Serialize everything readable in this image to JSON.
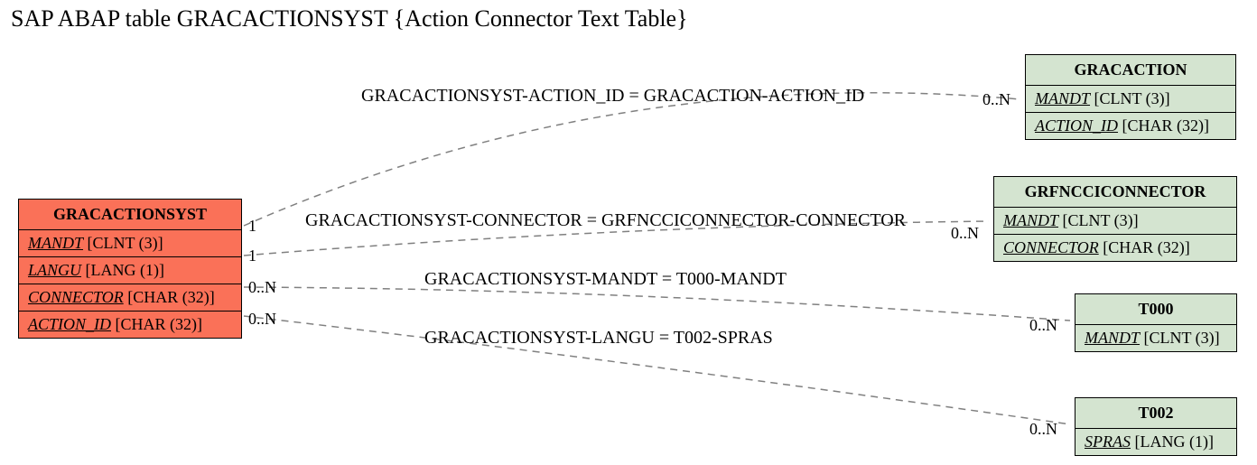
{
  "title": "SAP ABAP table GRACACTIONSYST {Action Connector Text Table}",
  "entities": {
    "main": {
      "name": "GRACACTIONSYST",
      "fields": [
        {
          "key": "MANDT",
          "type": "[CLNT (3)]"
        },
        {
          "key": "LANGU",
          "type": "[LANG (1)]"
        },
        {
          "key": "CONNECTOR",
          "type": "[CHAR (32)]"
        },
        {
          "key": "ACTION_ID",
          "type": "[CHAR (32)]"
        }
      ]
    },
    "e1": {
      "name": "GRACACTION",
      "fields": [
        {
          "key": "MANDT",
          "type": "[CLNT (3)]"
        },
        {
          "key": "ACTION_ID",
          "type": "[CHAR (32)]"
        }
      ]
    },
    "e2": {
      "name": "GRFNCCICONNECTOR",
      "fields": [
        {
          "key": "MANDT",
          "type": "[CLNT (3)]"
        },
        {
          "key": "CONNECTOR",
          "type": "[CHAR (32)]"
        }
      ]
    },
    "e3": {
      "name": "T000",
      "fields": [
        {
          "key": "MANDT",
          "type": "[CLNT (3)]"
        }
      ]
    },
    "e4": {
      "name": "T002",
      "fields": [
        {
          "key": "SPRAS",
          "type": "[LANG (1)]"
        }
      ]
    }
  },
  "relations": {
    "r1": {
      "label": "GRACACTIONSYST-ACTION_ID = GRACACTION-ACTION_ID",
      "left_card": "1",
      "right_card": "0..N"
    },
    "r2": {
      "label": "GRACACTIONSYST-CONNECTOR = GRFNCCICONNECTOR-CONNECTOR",
      "left_card": "1",
      "right_card": "0..N"
    },
    "r3": {
      "label": "GRACACTIONSYST-MANDT = T000-MANDT",
      "left_card": "0..N",
      "right_card": "0..N"
    },
    "r4": {
      "label": "GRACACTIONSYST-LANGU = T002-SPRAS",
      "left_card": "0..N",
      "right_card": "0..N"
    }
  },
  "chart_data": {
    "type": "table",
    "description": "ER-diagram relationships for SAP ABAP table GRACACTIONSYST",
    "main_entity": {
      "name": "GRACACTIONSYST",
      "columns": [
        {
          "name": "MANDT",
          "datatype": "CLNT",
          "length": 3
        },
        {
          "name": "LANGU",
          "datatype": "LANG",
          "length": 1
        },
        {
          "name": "CONNECTOR",
          "datatype": "CHAR",
          "length": 32
        },
        {
          "name": "ACTION_ID",
          "datatype": "CHAR",
          "length": 32
        }
      ]
    },
    "related_entities": [
      {
        "name": "GRACACTION",
        "columns": [
          {
            "name": "MANDT",
            "datatype": "CLNT",
            "length": 3
          },
          {
            "name": "ACTION_ID",
            "datatype": "CHAR",
            "length": 32
          }
        ]
      },
      {
        "name": "GRFNCCICONNECTOR",
        "columns": [
          {
            "name": "MANDT",
            "datatype": "CLNT",
            "length": 3
          },
          {
            "name": "CONNECTOR",
            "datatype": "CHAR",
            "length": 32
          }
        ]
      },
      {
        "name": "T000",
        "columns": [
          {
            "name": "MANDT",
            "datatype": "CLNT",
            "length": 3
          }
        ]
      },
      {
        "name": "T002",
        "columns": [
          {
            "name": "SPRAS",
            "datatype": "LANG",
            "length": 1
          }
        ]
      }
    ],
    "relationships": [
      {
        "from": "GRACACTIONSYST.ACTION_ID",
        "to": "GRACACTION.ACTION_ID",
        "from_card": "1",
        "to_card": "0..N"
      },
      {
        "from": "GRACACTIONSYST.CONNECTOR",
        "to": "GRFNCCICONNECTOR.CONNECTOR",
        "from_card": "1",
        "to_card": "0..N"
      },
      {
        "from": "GRACACTIONSYST.MANDT",
        "to": "T000.MANDT",
        "from_card": "0..N",
        "to_card": "0..N"
      },
      {
        "from": "GRACACTIONSYST.LANGU",
        "to": "T002.SPRAS",
        "from_card": "0..N",
        "to_card": "0..N"
      }
    ]
  }
}
